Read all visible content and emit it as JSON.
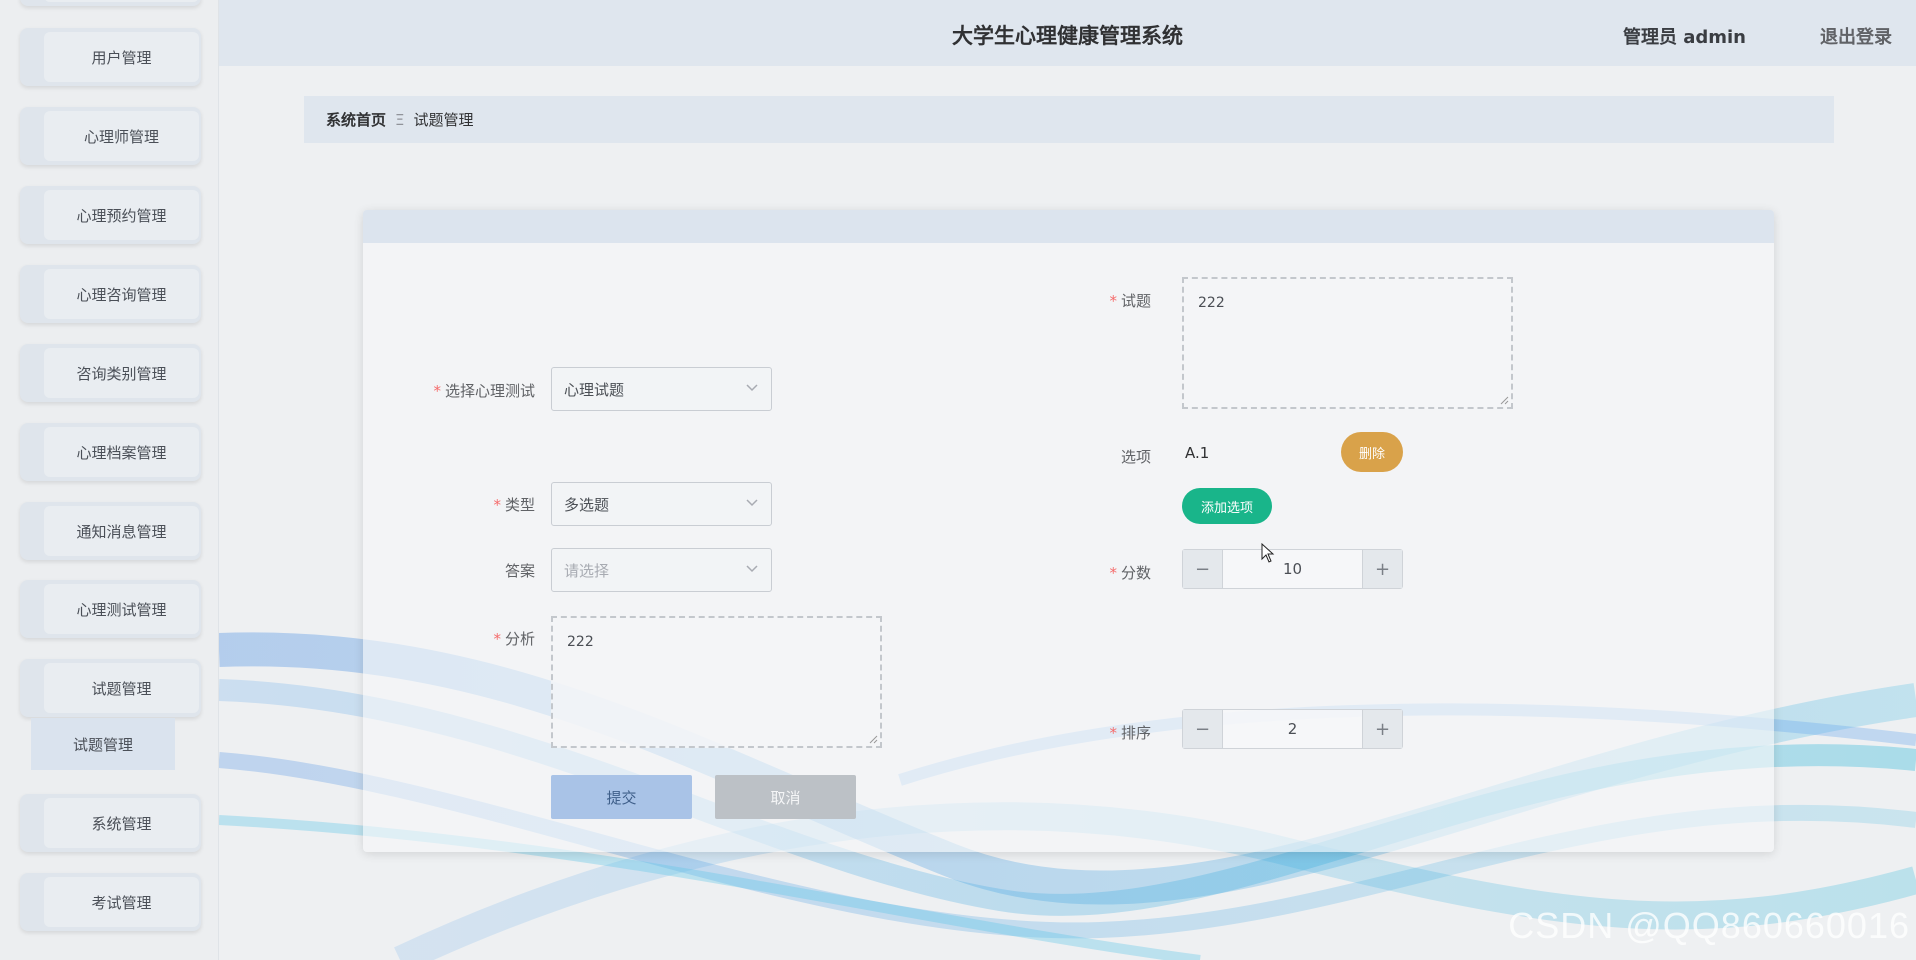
{
  "app": {
    "title": "大学生心理健康管理系统",
    "user": "管理员 admin",
    "logout": "退出登录"
  },
  "sidebar": {
    "items": [
      {
        "label": "用户管理"
      },
      {
        "label": "心理师管理"
      },
      {
        "label": "心理预约管理"
      },
      {
        "label": "心理咨询管理"
      },
      {
        "label": "咨询类别管理"
      },
      {
        "label": "心理档案管理"
      },
      {
        "label": "通知消息管理"
      },
      {
        "label": "心理测试管理"
      },
      {
        "label": "试题管理"
      },
      {
        "label": "系统管理"
      },
      {
        "label": "考试管理"
      }
    ],
    "active_sub": "试题管理"
  },
  "breadcrumb": {
    "home": "系统首页",
    "separator": "Ξ",
    "current": "试题管理"
  },
  "form": {
    "test_select": {
      "label": "选择心理测试",
      "value": "心理试题"
    },
    "type_select": {
      "label": "类型",
      "value": "多选题"
    },
    "answer_select": {
      "label": "答案",
      "placeholder": "请选择"
    },
    "analysis": {
      "label": "分析",
      "value": "222"
    },
    "question": {
      "label": "试题",
      "value": "222"
    },
    "options": {
      "label": "选项",
      "items": [
        {
          "text": "A.1",
          "delete_label": "删除"
        }
      ],
      "add_label": "添加选项"
    },
    "score": {
      "label": "分数",
      "value": "10"
    },
    "sort": {
      "label": "排序",
      "value": "2"
    },
    "submit_label": "提交",
    "cancel_label": "取消"
  },
  "watermark": "CSDN @QQ860660016",
  "colors": {
    "accent_green": "#19b58a",
    "danger_orange": "#d9a24a",
    "required": "#f56c6c",
    "submit_blue": "#a9c3e7"
  }
}
